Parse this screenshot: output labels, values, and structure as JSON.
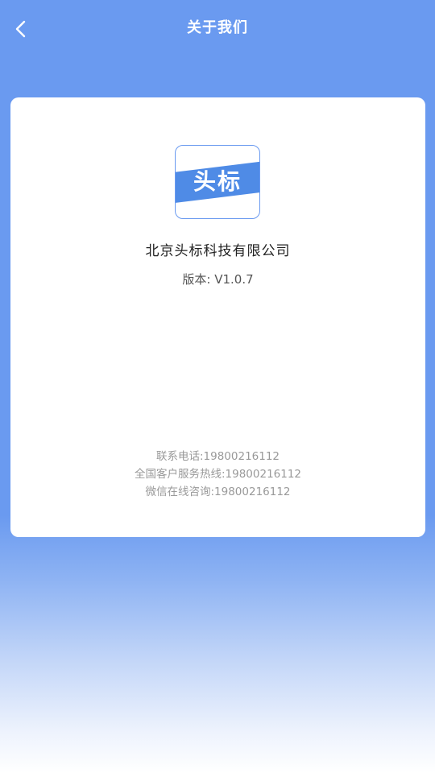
{
  "header": {
    "title": "关于我们",
    "back_icon": "chevron-left-icon"
  },
  "about": {
    "logo_text": "头标",
    "company_name": "北京头标科技有限公司",
    "version": "版本: V1.0.7"
  },
  "contacts": [
    "联系电话:19800216112",
    "全国客户服务热线:19800216112",
    "微信在线咨询:19800216112"
  ],
  "colors": {
    "primary": "#6a9af0",
    "logo_band": "#4f8be6"
  }
}
